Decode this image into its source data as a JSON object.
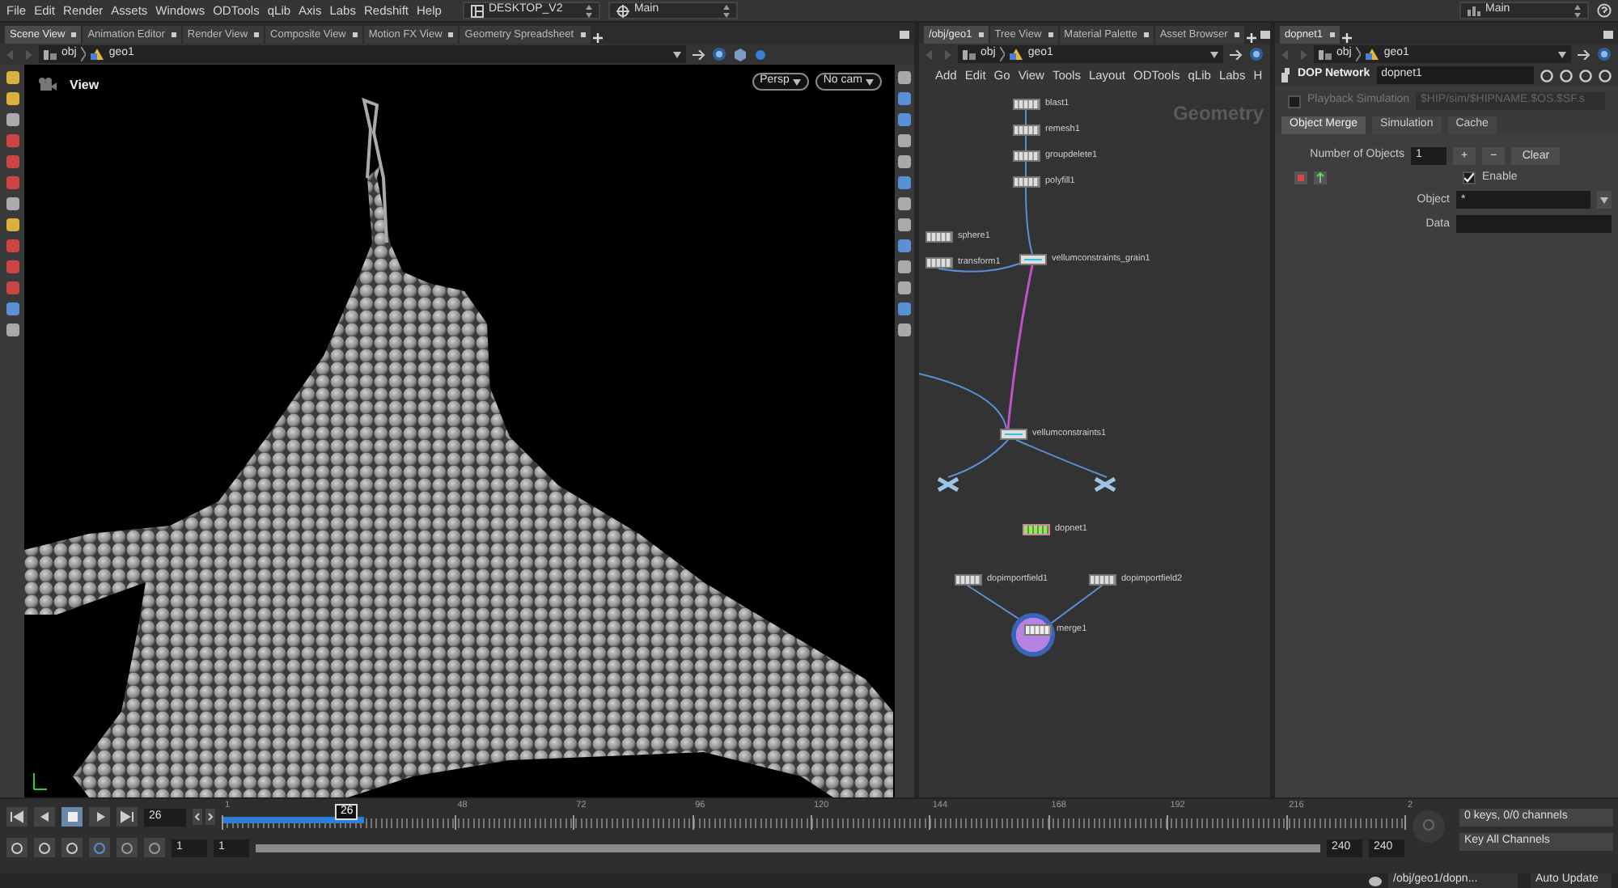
{
  "menu_bar": {
    "menus": [
      "File",
      "Edit",
      "Render",
      "Assets",
      "Windows",
      "ODTools",
      "qLib",
      "Axis",
      "Labs",
      "Redshift",
      "Help"
    ],
    "desktop": "DESKTOP_V2",
    "desk_set": "Main",
    "right_desk": "Main"
  },
  "scene_pane": {
    "tabs": [
      {
        "label": "Scene View",
        "selected": true
      },
      {
        "label": "Animation Editor",
        "selected": false
      },
      {
        "label": "Render View",
        "selected": false
      },
      {
        "label": "Composite View",
        "selected": false
      },
      {
        "label": "Motion FX View",
        "selected": false
      },
      {
        "label": "Geometry Spreadsheet",
        "selected": false
      }
    ],
    "path": [
      "obj",
      "geo1"
    ],
    "viewport": {
      "title": "View",
      "camera_buttons": [
        "Persp",
        "No cam"
      ]
    }
  },
  "network_pane": {
    "tabs": [
      {
        "label": "/obj/geo1",
        "selected": true
      },
      {
        "label": "Tree View",
        "selected": false
      },
      {
        "label": "Material Palette",
        "selected": false
      },
      {
        "label": "Asset Browser",
        "selected": false
      }
    ],
    "path": [
      "obj",
      "geo1"
    ],
    "menus": [
      "Add",
      "Edit",
      "Go",
      "View",
      "Tools",
      "Layout",
      "ODTools",
      "qLib",
      "Labs",
      "H"
    ],
    "context_label": "Geometry",
    "nodes": [
      {
        "label": "blast1",
        "kind": "sop"
      },
      {
        "label": "remesh1",
        "kind": "sop"
      },
      {
        "label": "groupdelete1",
        "kind": "sop"
      },
      {
        "label": "polyfill1",
        "kind": "sop"
      },
      {
        "label": "sphere1",
        "kind": "sop"
      },
      {
        "label": "transform1",
        "kind": "sop"
      },
      {
        "label": "vellumconstraints_grain1",
        "kind": "vellum"
      },
      {
        "label": "vellumconstraints1",
        "kind": "vellum"
      },
      {
        "label": "dopnet1",
        "kind": "dop"
      },
      {
        "label": "dopimportfield1",
        "kind": "sop"
      },
      {
        "label": "dopimportfield2",
        "kind": "sop"
      },
      {
        "label": "merge1",
        "kind": "merge"
      }
    ]
  },
  "parameter_pane": {
    "tabs": [
      {
        "label": "dopnet1",
        "selected": true
      }
    ],
    "path": [
      "obj",
      "geo1"
    ],
    "network_type": "DOP Network",
    "node_name": "dopnet1",
    "playback": {
      "label": "Playback Simulation",
      "checked": false,
      "path": "$HIP/sim/$HIPNAME.$OS.$SF.s"
    },
    "param_tabs": [
      {
        "label": "Object Merge",
        "selected": true
      },
      {
        "label": "Simulation",
        "selected": false
      },
      {
        "label": "Cache",
        "selected": false
      }
    ],
    "number_of_objects": {
      "label": "Number of Objects",
      "value": "1",
      "add": "+",
      "remove": "−",
      "clear": "Clear"
    },
    "enable": {
      "label": "Enable",
      "checked": true
    },
    "object": {
      "label": "Object",
      "value": "*"
    },
    "data": {
      "label": "Data"
    }
  },
  "timeline": {
    "frame": "26",
    "marker": "26",
    "cache": {
      "level": 0.12
    },
    "ticks": [
      "1",
      "48",
      "72",
      "96",
      "120",
      "144",
      "168",
      "192",
      "216",
      "2"
    ],
    "playback_buttons": [
      {
        "kind": "first",
        "selected": false
      },
      {
        "kind": "back",
        "selected": false
      },
      {
        "kind": "stop",
        "selected": true
      },
      {
        "kind": "play",
        "selected": false
      },
      {
        "kind": "last",
        "selected": false
      }
    ],
    "range": {
      "level": 1,
      "start": "1",
      "sub_start": "1",
      "sub_end": "240",
      "end": "240"
    },
    "keys": "0 keys, 0/0 channels",
    "key_mode": "Key All Channels"
  },
  "status_bar": {
    "path": "/obj/geo1/dopn...",
    "update_mode": "Auto Update"
  }
}
